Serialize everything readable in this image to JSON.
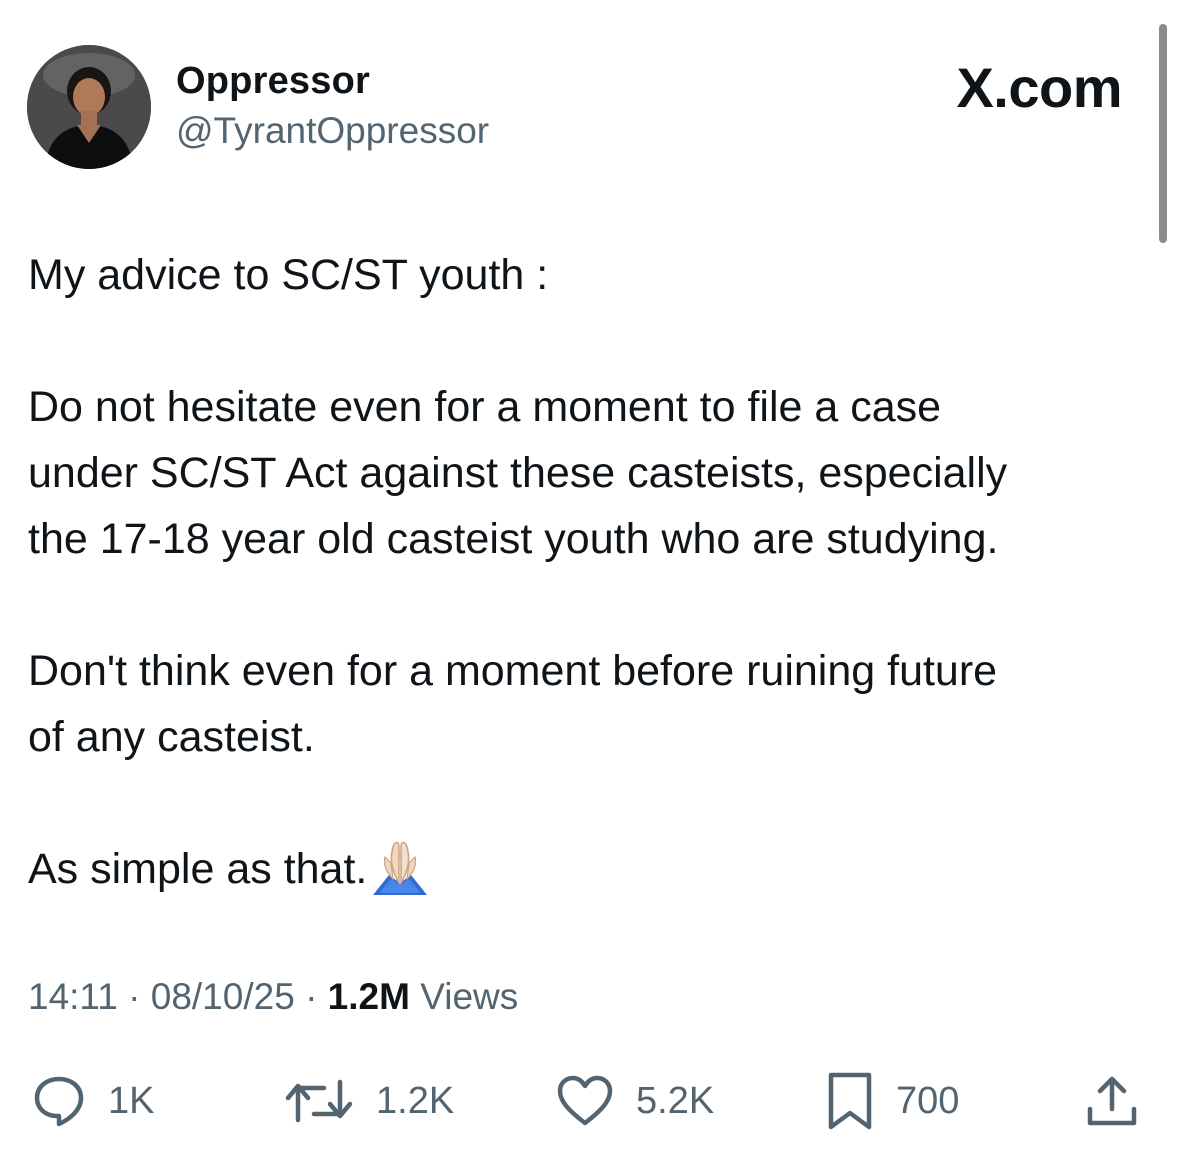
{
  "author": {
    "display_name": "Oppressor",
    "handle": "@TyrantOppressor"
  },
  "site_logo": "X.com",
  "tweet": {
    "paragraphs": [
      "My advice to SC/ST youth :",
      "Do not hesitate even for a moment to file a case\nunder SC/ST Act against these casteists, especially\nthe 17-18 year old casteist youth who are studying.",
      "Don't think even for a moment before ruining future\nof any casteist.",
      "As simple as that."
    ],
    "emoji": "folded-hands"
  },
  "meta": {
    "time": "14:11",
    "separator": "·",
    "date": "08/10/25",
    "views_count": "1.2M",
    "views_label": "Views"
  },
  "actions": {
    "replies": "1K",
    "reposts": "1.2K",
    "likes": "5.2K",
    "bookmarks": "700"
  },
  "colors": {
    "text": "#0f1419",
    "secondary": "#536471",
    "background": "#ffffff"
  },
  "icons": [
    "avatar",
    "folded-hands-icon",
    "reply-icon",
    "repost-icon",
    "like-icon",
    "bookmark-icon",
    "share-icon"
  ]
}
